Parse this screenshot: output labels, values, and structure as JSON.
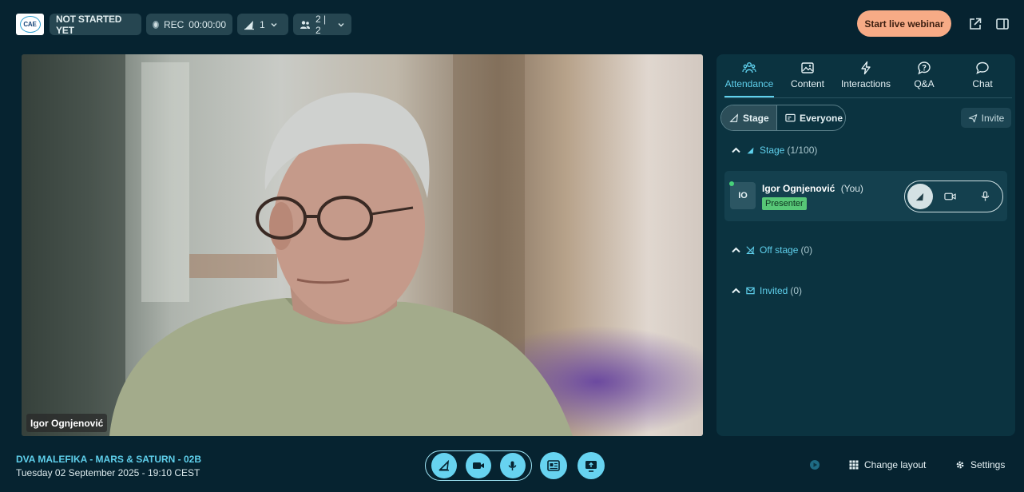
{
  "topbar": {
    "logo_text": "CAE",
    "status": "NOT STARTED YET",
    "rec_label": "REC",
    "rec_time": "00:00:00",
    "stage_count": "1",
    "users_count": "2 | 2",
    "start_button": "Start live webinar",
    "icons": [
      "popout-icon",
      "panel-toggle-icon"
    ]
  },
  "video": {
    "participant_name": "Igor Ognjenović"
  },
  "panel": {
    "tabs": [
      {
        "label": "Attendance",
        "icon": "attendance-icon",
        "active": true
      },
      {
        "label": "Content",
        "icon": "image-icon",
        "active": false
      },
      {
        "label": "Interactions",
        "icon": "lightning-icon",
        "active": false
      },
      {
        "label": "Q&A",
        "icon": "question-icon",
        "active": false
      },
      {
        "label": "Chat",
        "icon": "chat-icon",
        "active": false
      }
    ],
    "filter_stage": "Stage",
    "filter_everyone": "Everyone",
    "invite": "Invite",
    "sections": {
      "stage": {
        "label": "Stage",
        "count": "(1/100)"
      },
      "off_stage": {
        "label": "Off stage",
        "count": "(0)"
      },
      "invited": {
        "label": "Invited",
        "count": "(0)"
      }
    },
    "person": {
      "initials": "IO",
      "name": "Igor Ognjenović",
      "you": "(You)",
      "role": "Presenter"
    }
  },
  "bottombar": {
    "event_title": "DVA MALEFIKA - MARS & SATURN - 02B",
    "event_date": "Tuesday 02 September 2025 - 19:10 CEST",
    "change_layout": "Change layout",
    "settings": "Settings"
  },
  "colors": {
    "background": "#062330",
    "accent": "#5fd0ec",
    "start_button": "#f7ab86",
    "presenter_badge": "#57c777"
  }
}
